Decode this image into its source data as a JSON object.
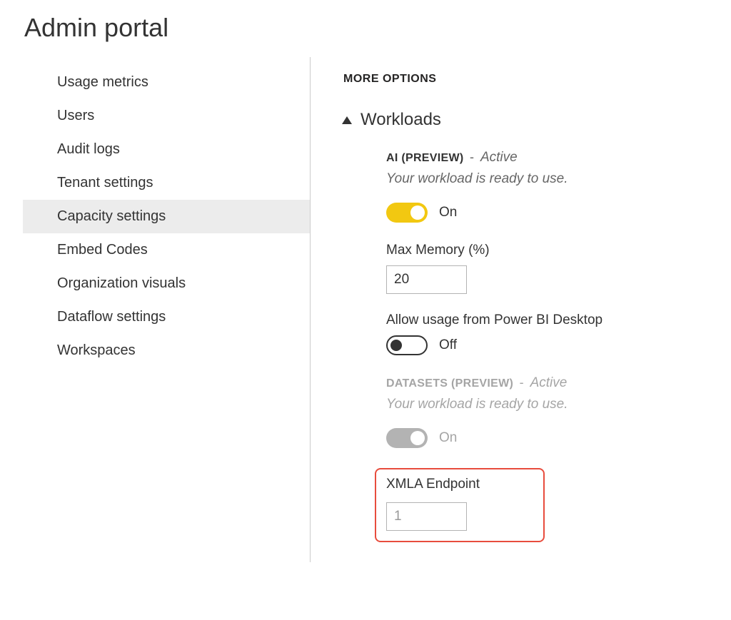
{
  "page": {
    "title": "Admin portal"
  },
  "sidebar": {
    "items": [
      {
        "label": "Usage metrics",
        "selected": false
      },
      {
        "label": "Users",
        "selected": false
      },
      {
        "label": "Audit logs",
        "selected": false
      },
      {
        "label": "Tenant settings",
        "selected": false
      },
      {
        "label": "Capacity settings",
        "selected": true
      },
      {
        "label": "Embed Codes",
        "selected": false
      },
      {
        "label": "Organization visuals",
        "selected": false
      },
      {
        "label": "Dataflow settings",
        "selected": false
      },
      {
        "label": "Workspaces",
        "selected": false
      }
    ]
  },
  "main": {
    "sectionHeader": "MORE OPTIONS",
    "workloadsTitle": "Workloads",
    "ai": {
      "name": "AI (PREVIEW)",
      "status": "Active",
      "desc": "Your workload is ready to use.",
      "toggleLabel": "On",
      "maxMemoryLabel": "Max Memory (%)",
      "maxMemoryValue": "20",
      "allowUsageLabel": "Allow usage from Power BI Desktop",
      "allowUsageToggleLabel": "Off"
    },
    "datasets": {
      "name": "DATASETS (PREVIEW)",
      "status": "Active",
      "desc": "Your workload is ready to use.",
      "toggleLabel": "On",
      "xmlaLabel": "XMLA Endpoint",
      "xmlaValue": "1"
    }
  }
}
